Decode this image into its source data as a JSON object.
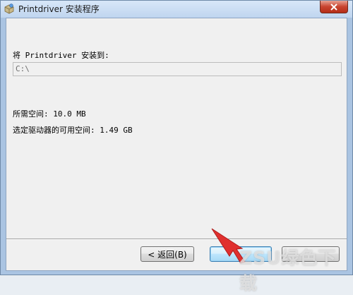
{
  "window": {
    "title": "Printdriver 安装程序",
    "app_icon": "installer-box-icon",
    "close_icon": "close-icon"
  },
  "main": {
    "install_label": "将 Printdriver 安装到:",
    "path_value": "C:\\",
    "space_required": "所需空间: 10.0 MB",
    "space_available": "选定驱动器的可用空间: 1.49 GB"
  },
  "buttons": {
    "back_label": "< 返回(B)",
    "install_label": "",
    "cancel_label": ""
  },
  "overlay": {
    "pointer_color": "#e0302f",
    "watermark_text": "ZSU绿色下载"
  }
}
